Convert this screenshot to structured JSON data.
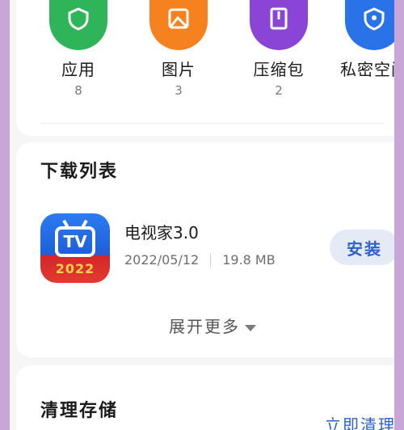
{
  "categories": [
    {
      "name": "应用",
      "count": "8",
      "color": "#2fb45a",
      "icon": "shield-app-icon"
    },
    {
      "name": "图片",
      "count": "3",
      "color": "#f5821f",
      "icon": "image-icon"
    },
    {
      "name": "压缩包",
      "count": "2",
      "color": "#8b45d6",
      "icon": "archive-icon"
    },
    {
      "name": "私密空间",
      "count": "",
      "color": "#2a72e8",
      "icon": "lock-shield-icon"
    }
  ],
  "downloads": {
    "title": "下载列表",
    "app": {
      "name": "电视家3.0",
      "date": "2022/05/12",
      "size": "19.8 MB",
      "icon_text": "TV",
      "icon_year": "2022",
      "install_label": "安装"
    },
    "expand_label": "展开更多"
  },
  "cleanup": {
    "title": "清理存储",
    "action_label": "立即清理"
  },
  "colors": {
    "accent": "#2d62c6",
    "background": "#c9a6d8"
  }
}
